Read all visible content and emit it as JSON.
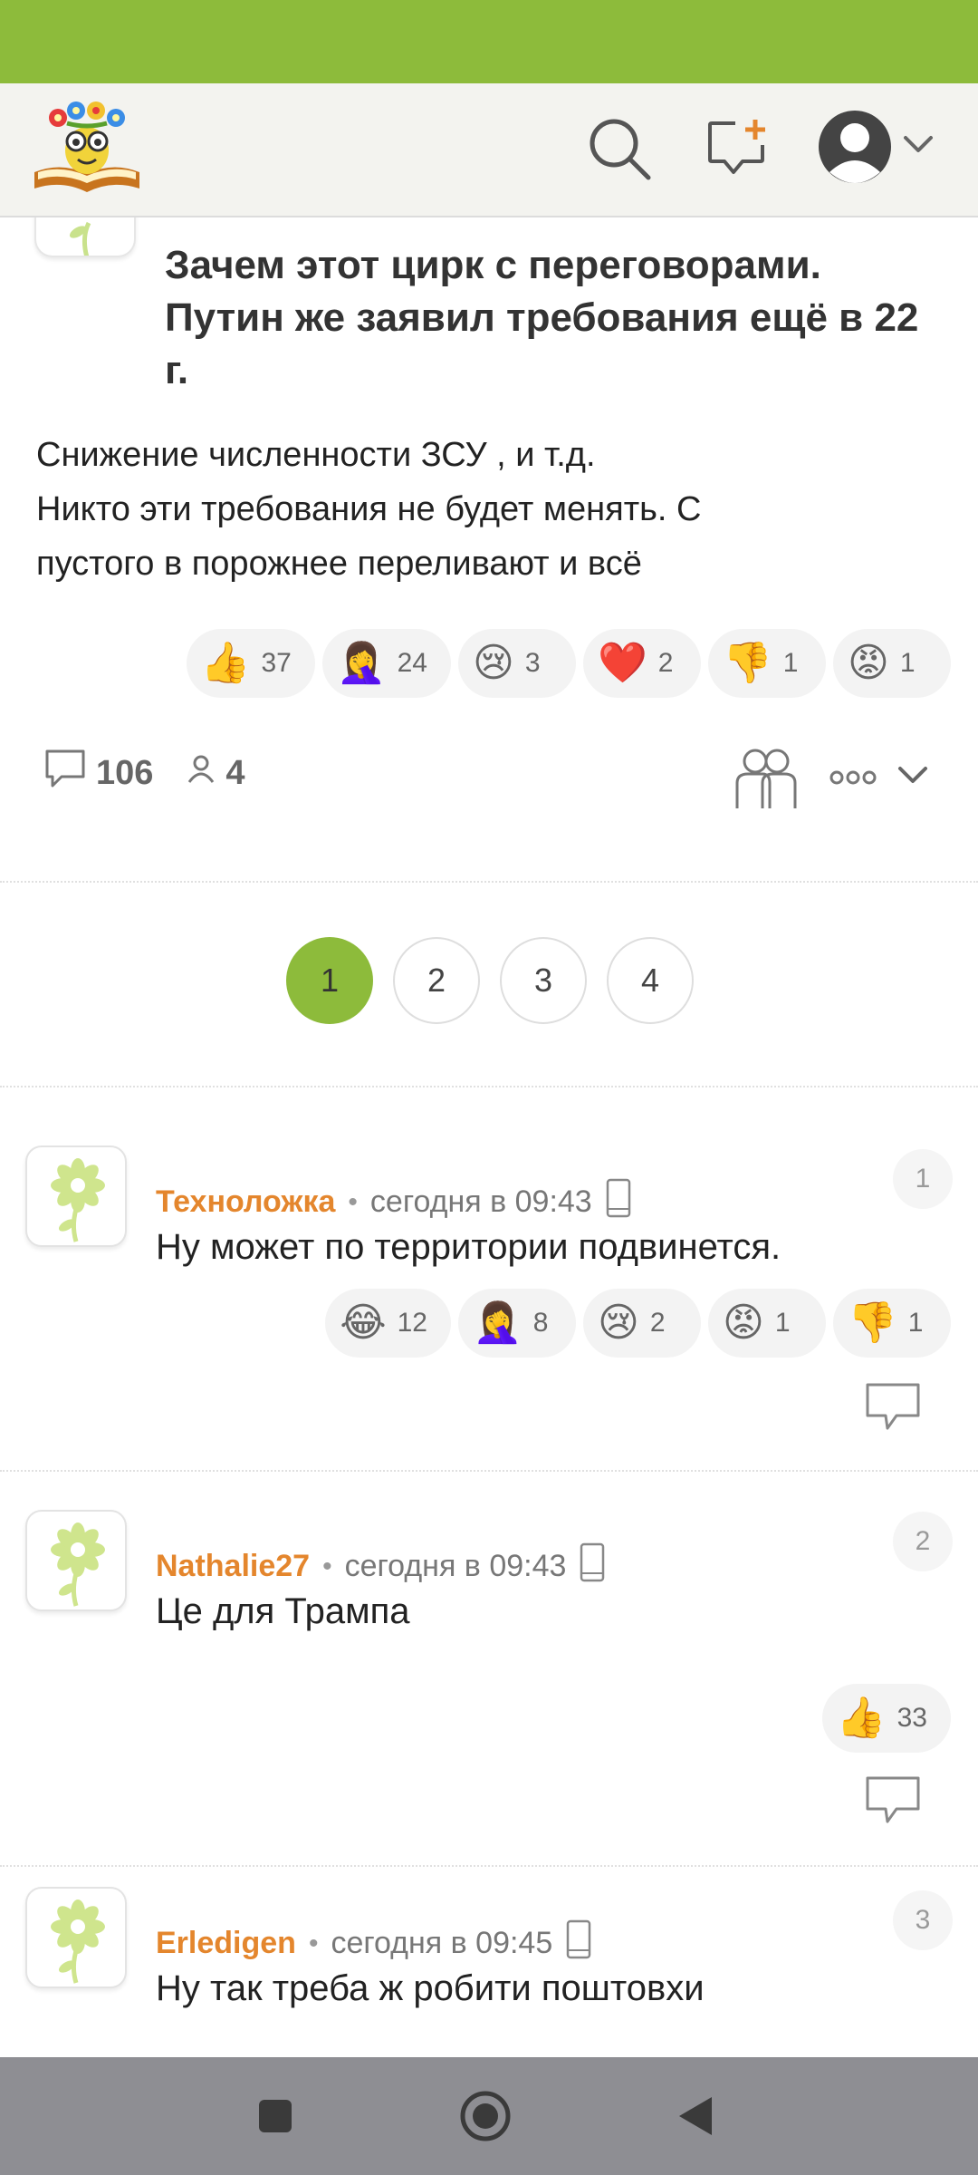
{
  "post": {
    "title": "Зачем этот цирк с переговорами. Путин же заявил требования ещё в 22 г.",
    "body_lines": [
      "Снижение численности ЗСУ , и т.д.",
      "Никто эти требования не будет менять. С",
      "пустого в порожнее переливают и всё"
    ],
    "reactions": [
      {
        "emoji": "👍",
        "count": "37"
      },
      {
        "emoji": "🤦‍♀️",
        "count": "24"
      },
      {
        "emoji": "😢",
        "count": "3"
      },
      {
        "emoji": "❤️",
        "count": "2"
      },
      {
        "emoji": "👎",
        "count": "1"
      },
      {
        "emoji": "😡",
        "count": "1"
      }
    ],
    "comments_count": "106",
    "participants_count": "4"
  },
  "pagination": {
    "pages": [
      "1",
      "2",
      "3",
      "4"
    ],
    "active": "1"
  },
  "comments": [
    {
      "author": "Техноложка",
      "dot": "•",
      "time": "сегодня в 09:43",
      "number": "1",
      "text": "Ну может по территории подвинется.",
      "reactions": [
        {
          "emoji": "😂",
          "count": "12"
        },
        {
          "emoji": "🤦‍♀️",
          "count": "8"
        },
        {
          "emoji": "😢",
          "count": "2"
        },
        {
          "emoji": "😡",
          "count": "1"
        },
        {
          "emoji": "👎",
          "count": "1"
        }
      ]
    },
    {
      "author": "Nathalie27",
      "dot": "•",
      "time": "сегодня в 09:43",
      "number": "2",
      "text": "Це для Трампа",
      "reactions": [
        {
          "emoji": "👍",
          "count": "33"
        }
      ]
    },
    {
      "author": "Erledigen",
      "dot": "•",
      "time": "сегодня в 09:45",
      "number": "3",
      "text": "Ну так треба ж робити поштовхи",
      "reactions": []
    }
  ],
  "colors": {
    "brand_green": "#8dbb3b",
    "author_orange": "#e4862d",
    "navbar_gray": "#8e8e93"
  },
  "icons": {
    "header": [
      "search-icon",
      "add-post-icon",
      "profile-icon",
      "chevron-down-icon"
    ],
    "post_actions": [
      "comments-icon",
      "participants-icon",
      "group-icon",
      "more-icon",
      "chevron-down-icon"
    ],
    "comment": [
      "flower-avatar-icon",
      "phone-device-icon",
      "reply-icon"
    ],
    "navbar": [
      "recent-apps-icon",
      "home-icon",
      "back-icon"
    ]
  }
}
